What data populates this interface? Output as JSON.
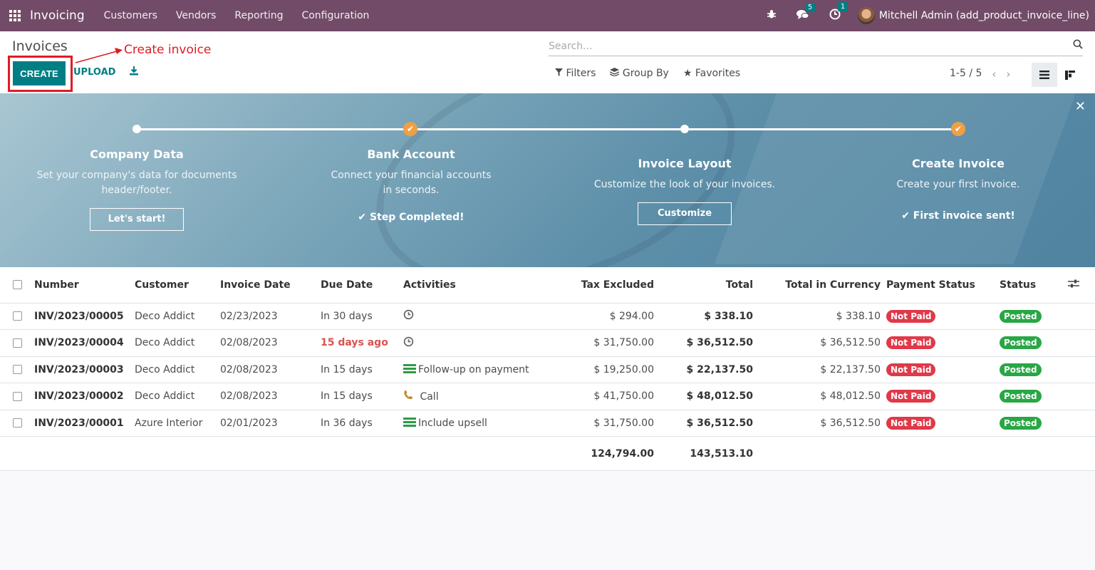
{
  "navbar": {
    "app_name": "Invoicing",
    "menu": [
      "Customers",
      "Vendors",
      "Reporting",
      "Configuration"
    ],
    "messages_count": "5",
    "activities_count": "1",
    "user": "Mitchell Admin (add_product_invoice_line)"
  },
  "control": {
    "title": "Invoices",
    "create_label": "CREATE",
    "upload_label": "UPLOAD",
    "annotation": "Create invoice",
    "search_placeholder": "Search...",
    "filters_label": "Filters",
    "groupby_label": "Group By",
    "favorites_label": "Favorites",
    "pager": "1-5 / 5"
  },
  "banner": {
    "steps": [
      {
        "title": "Company Data",
        "desc": "Set your company's data for documents header/footer.",
        "button": "Let's start!",
        "done": ""
      },
      {
        "title": "Bank Account",
        "desc": "Connect your financial accounts in seconds.",
        "button": "",
        "done": "Step Completed!"
      },
      {
        "title": "Invoice Layout",
        "desc": "Customize the look of your invoices.",
        "button": "Customize",
        "done": ""
      },
      {
        "title": "Create Invoice",
        "desc": "Create your first invoice.",
        "button": "",
        "done": "First invoice sent!"
      }
    ]
  },
  "table": {
    "headers": {
      "number": "Number",
      "customer": "Customer",
      "invoice_date": "Invoice Date",
      "due_date": "Due Date",
      "activities": "Activities",
      "tax_excluded": "Tax Excluded",
      "total": "Total",
      "total_currency": "Total in Currency",
      "payment_status": "Payment Status",
      "status": "Status"
    },
    "rows": [
      {
        "number": "INV/2023/00005",
        "customer": "Deco Addict",
        "invoice_date": "02/23/2023",
        "due_date": "In 30 days",
        "activity": "",
        "tax_excluded": "$ 294.00",
        "total": "$ 338.10",
        "total_currency": "$ 338.10",
        "payment_status": "Not Paid",
        "status": "Posted"
      },
      {
        "number": "INV/2023/00004",
        "customer": "Deco Addict",
        "invoice_date": "02/08/2023",
        "due_date": "15 days ago",
        "activity": "",
        "tax_excluded": "$ 31,750.00",
        "total": "$ 36,512.50",
        "total_currency": "$ 36,512.50",
        "payment_status": "Not Paid",
        "status": "Posted"
      },
      {
        "number": "INV/2023/00003",
        "customer": "Deco Addict",
        "invoice_date": "02/08/2023",
        "due_date": "In 15 days",
        "activity": "Follow-up on payment",
        "tax_excluded": "$ 19,250.00",
        "total": "$ 22,137.50",
        "total_currency": "$ 22,137.50",
        "payment_status": "Not Paid",
        "status": "Posted"
      },
      {
        "number": "INV/2023/00002",
        "customer": "Deco Addict",
        "invoice_date": "02/08/2023",
        "due_date": "In 15 days",
        "activity": "Call",
        "tax_excluded": "$ 41,750.00",
        "total": "$ 48,012.50",
        "total_currency": "$ 48,012.50",
        "payment_status": "Not Paid",
        "status": "Posted"
      },
      {
        "number": "INV/2023/00001",
        "customer": "Azure Interior",
        "invoice_date": "02/01/2023",
        "due_date": "In 36 days",
        "activity": "Include upsell",
        "tax_excluded": "$ 31,750.00",
        "total": "$ 36,512.50",
        "total_currency": "$ 36,512.50",
        "payment_status": "Not Paid",
        "status": "Posted"
      }
    ],
    "totals": {
      "tax_excluded": "124,794.00",
      "total": "143,513.10"
    }
  },
  "colors": {
    "brand": "#714b67",
    "primary": "#017e84",
    "danger": "#e0394a",
    "success": "#28a745",
    "annotation": "#e01b24"
  }
}
